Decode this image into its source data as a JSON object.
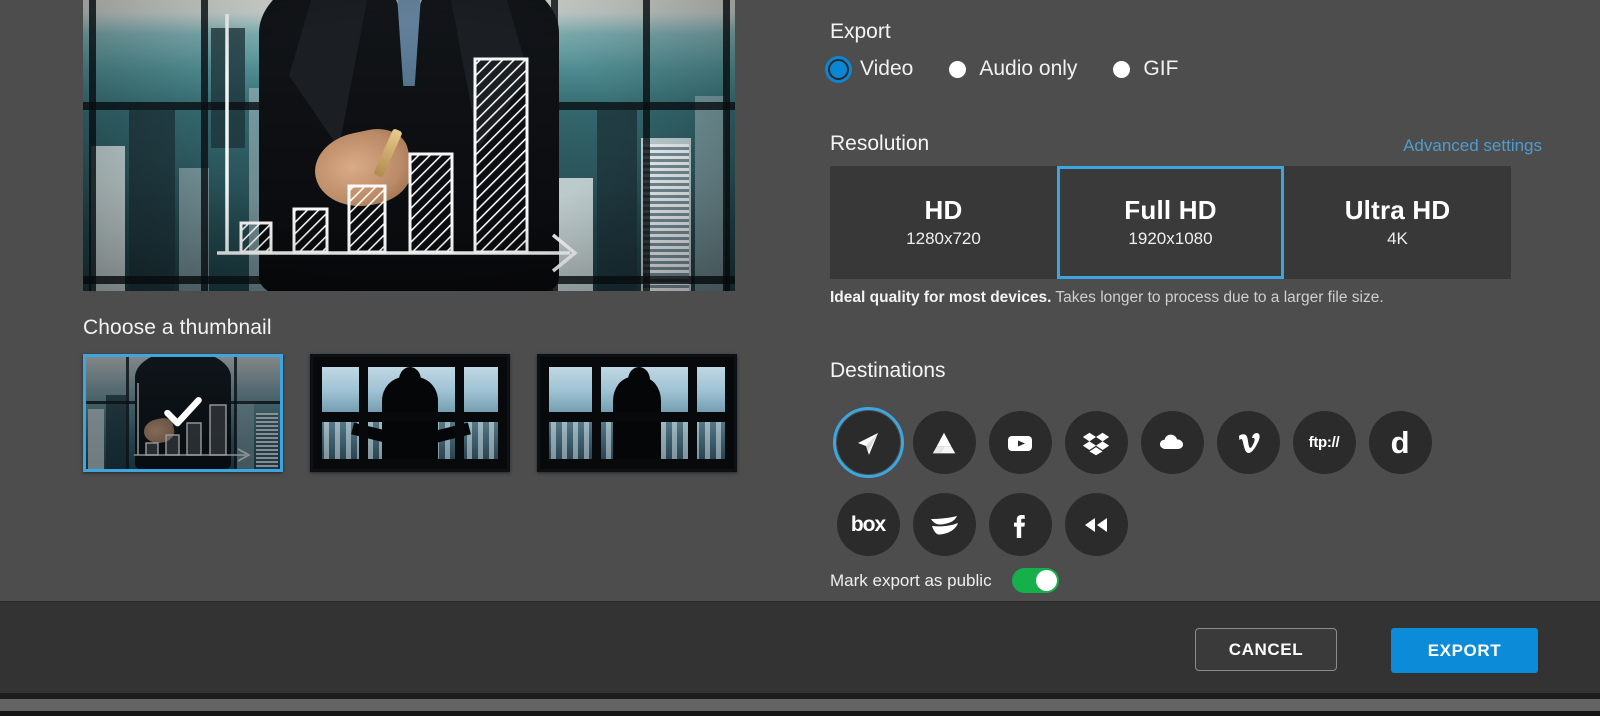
{
  "preview": {
    "alt": "Businessman pointing at rising hand-drawn bar chart over city skyline"
  },
  "thumbnails": {
    "title": "Choose a thumbnail",
    "items": [
      {
        "name": "thumbnail-1",
        "selected": true,
        "scene": "businessman-chart",
        "check_icon": "check-icon"
      },
      {
        "name": "thumbnail-2",
        "selected": false,
        "scene": "businessman-window-arms-out"
      },
      {
        "name": "thumbnail-3",
        "selected": false,
        "scene": "businessman-window-standing"
      }
    ]
  },
  "export": {
    "title": "Export",
    "options": [
      {
        "label": "Video",
        "selected": true
      },
      {
        "label": "Audio only",
        "selected": false
      },
      {
        "label": "GIF",
        "selected": false
      }
    ]
  },
  "resolution": {
    "title": "Resolution",
    "advanced_link": "Advanced settings",
    "cards": [
      {
        "name": "HD",
        "sub": "1280x720",
        "selected": false
      },
      {
        "name": "Full HD",
        "sub": "1920x1080",
        "selected": true
      },
      {
        "name": "Ultra HD",
        "sub": "4K",
        "selected": false
      }
    ],
    "description_bold": "Ideal quality for most devices.",
    "description_rest": " Takes longer to process due to a larger file size."
  },
  "destinations": {
    "title": "Destinations",
    "rows": [
      [
        {
          "id": "screencast",
          "icon": "paper-plane-icon",
          "label": "",
          "selected": true
        },
        {
          "id": "googledrive",
          "icon": "google-drive-icon",
          "label": "",
          "selected": false
        },
        {
          "id": "youtube",
          "icon": "youtube-icon",
          "label": "",
          "selected": false
        },
        {
          "id": "dropbox",
          "icon": "dropbox-icon",
          "label": "",
          "selected": false
        },
        {
          "id": "onedrive",
          "icon": "cloud-icon",
          "label": "",
          "selected": false
        },
        {
          "id": "vimeo",
          "icon": "vimeo-icon",
          "label": "",
          "selected": false
        },
        {
          "id": "ftp",
          "icon": "ftp-icon",
          "label": "ftp://",
          "selected": false
        },
        {
          "id": "dailymotion",
          "icon": "dailymotion-icon",
          "label": "d",
          "selected": false
        }
      ],
      [
        {
          "id": "box",
          "icon": "box-icon",
          "label": "box",
          "selected": false
        },
        {
          "id": "wistia",
          "icon": "wistia-icon",
          "label": "",
          "selected": false
        },
        {
          "id": "facebook",
          "icon": "facebook-icon",
          "label": "",
          "selected": false
        },
        {
          "id": "rewind",
          "icon": "rewind-icon",
          "label": "",
          "selected": false
        }
      ]
    ]
  },
  "public": {
    "label": "Mark export as public",
    "enabled": true
  },
  "footer": {
    "cancel_label": "CANCEL",
    "export_label": "EXPORT"
  },
  "colors": {
    "accent_blue": "#3da5e0",
    "button_blue": "#0c8bd9",
    "toggle_green": "#16b04b",
    "background": "#4d4d4d",
    "footer": "#333333",
    "card": "#383838",
    "link_blue": "#4f9ccd"
  }
}
